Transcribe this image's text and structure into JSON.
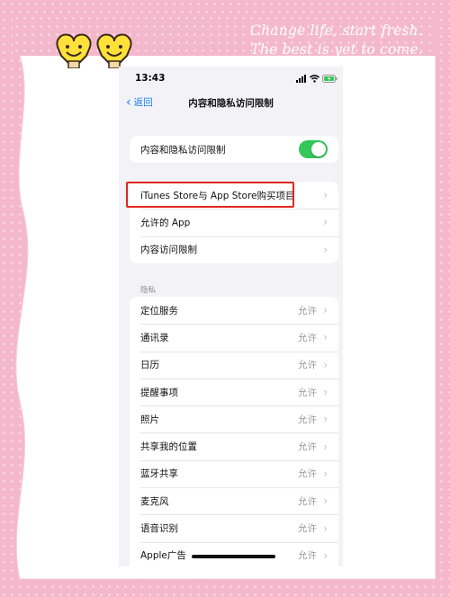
{
  "decoration": {
    "tagline": [
      "Change life, start fresh.",
      "The best is yet to come."
    ]
  },
  "status_bar": {
    "time": "13:43"
  },
  "nav": {
    "back_label": "返回",
    "title": "内容和隐私访问限制"
  },
  "main_toggle": {
    "label": "内容和隐私访问限制",
    "enabled": true
  },
  "restriction_items": [
    {
      "label": "iTunes Store与 App Store购买项目"
    },
    {
      "label": "允许的 App"
    },
    {
      "label": "内容访问限制"
    }
  ],
  "privacy": {
    "header": "隐私",
    "items": [
      {
        "label": "定位服务",
        "value": "允许"
      },
      {
        "label": "通讯录",
        "value": "允许"
      },
      {
        "label": "日历",
        "value": "允许"
      },
      {
        "label": "提醒事项",
        "value": "允许"
      },
      {
        "label": "照片",
        "value": "允许"
      },
      {
        "label": "共享我的位置",
        "value": "允许"
      },
      {
        "label": "蓝牙共享",
        "value": "允许"
      },
      {
        "label": "麦克风",
        "value": "允许"
      },
      {
        "label": "语音识别",
        "value": "允许"
      },
      {
        "label": "Apple广告",
        "value": "允许"
      }
    ]
  },
  "colors": {
    "accent": "#1a7ff5",
    "toggle_on": "#34c759",
    "highlight": "#e0261e",
    "frame": "#f4b8cc"
  }
}
